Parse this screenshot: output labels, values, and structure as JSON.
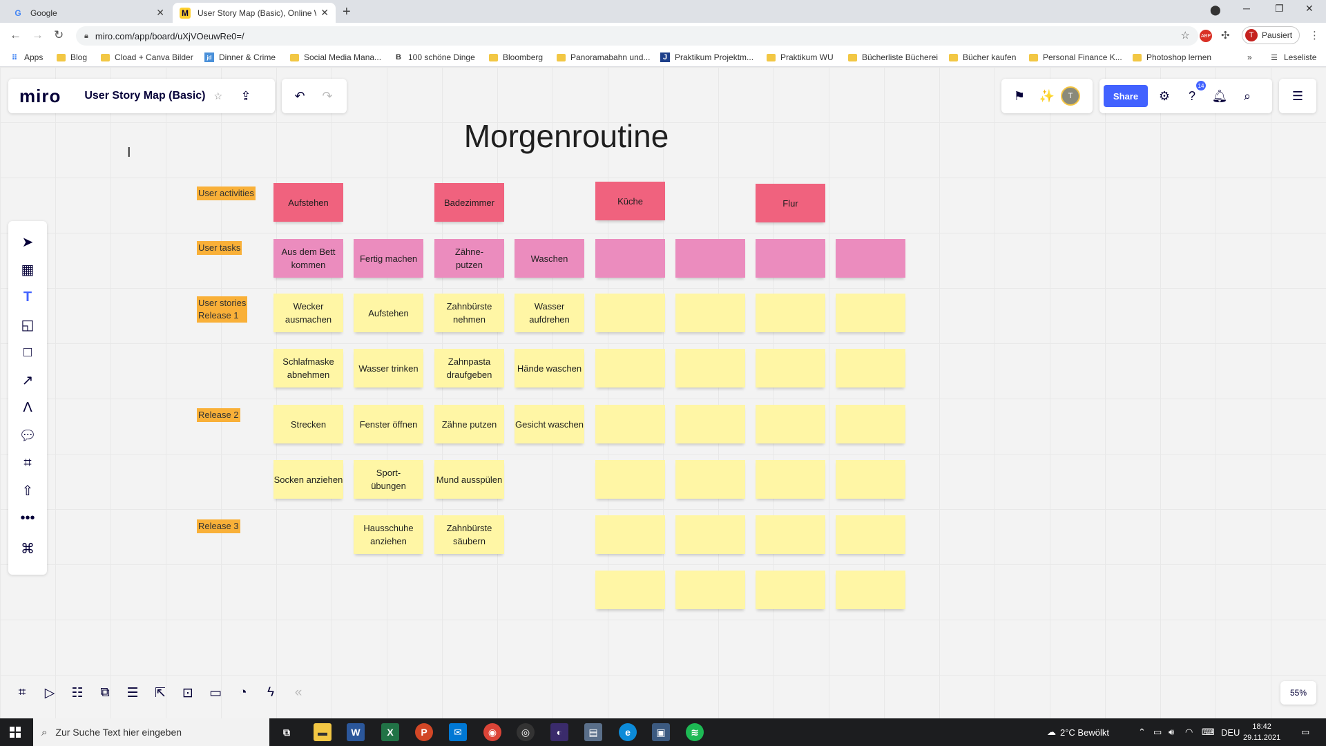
{
  "browser": {
    "tabs": [
      {
        "title": "Google",
        "favicon": "G"
      },
      {
        "title": "User Story Map (Basic), Online W",
        "favicon": "M"
      }
    ],
    "url": "miro.com/app/board/uXjVOeuwRe0=/",
    "profile_label": "Pausiert",
    "profile_initial": "T",
    "bookmarks": [
      "Apps",
      "Blog",
      "Cload + Canva Bilder",
      "Dinner & Crime",
      "Social Media Mana...",
      "100 schöne Dinge",
      "Bloomberg",
      "Panoramabahn und...",
      "Praktikum Projektm...",
      "Praktikum WU",
      "Bücherliste Bücherei",
      "Bücher kaufen",
      "Personal Finance K...",
      "Photoshop lernen"
    ],
    "reading_list": "Leseliste"
  },
  "miro": {
    "logo": "miro",
    "board_title": "User Story Map (Basic)",
    "share_label": "Share",
    "help_badge": "14",
    "avatar_initial": "T",
    "zoom": "55%"
  },
  "board": {
    "title": "Morgenroutine",
    "row_labels": {
      "activities": "User activities",
      "tasks": "User tasks",
      "stories": "User stories\nRelease 1",
      "release2": "Release 2",
      "release3": "Release 3"
    },
    "activities": [
      "Aufstehen",
      "Badezimmer",
      "Küche",
      "Flur"
    ],
    "tasks": [
      "Aus dem Bett kommen",
      "Fertig machen",
      "Zähne-\nputzen",
      "Waschen",
      "",
      "",
      "",
      ""
    ],
    "stories": [
      [
        "Wecker ausmachen",
        "Aufstehen",
        "Zahnbürste nehmen",
        "Wasser aufdrehen",
        "",
        "",
        "",
        ""
      ],
      [
        "Schlafmaske abnehmen",
        "Wasser trinken",
        "Zahnpasta draufgeben",
        "Hände waschen",
        "",
        "",
        "",
        ""
      ],
      [
        "Strecken",
        "Fenster öffnen",
        "Zähne putzen",
        "Gesicht waschen",
        "",
        "",
        "",
        ""
      ],
      [
        "Socken anziehen",
        "Sport-\nübungen",
        "Mund ausspülen",
        "",
        "",
        "",
        "",
        ""
      ],
      [
        "",
        "Hausschuhe anziehen",
        "Zahnbürste säubern",
        "",
        "",
        "",
        "",
        ""
      ],
      [
        "",
        "",
        "",
        "",
        "",
        "",
        "",
        ""
      ]
    ]
  },
  "taskbar": {
    "search_placeholder": "Zur Suche Text hier eingeben",
    "weather": "2°C  Bewölkt",
    "language": "DEU",
    "time": "18:42",
    "date": "29.11.2021"
  },
  "colors": {
    "activity": "#f0627e",
    "task": "#eb8cbe",
    "story": "#fff6a5",
    "label": "#f9b038",
    "share": "#4262ff"
  }
}
